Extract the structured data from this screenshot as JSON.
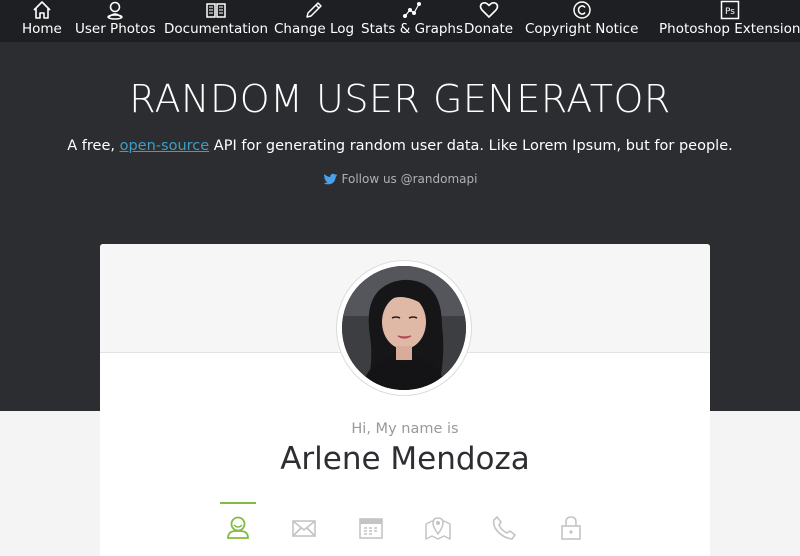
{
  "nav": {
    "items": [
      {
        "label": "Home",
        "icon": "home-icon"
      },
      {
        "label": "User Photos",
        "icon": "user-photos-icon"
      },
      {
        "label": "Documentation",
        "icon": "book-icon"
      },
      {
        "label": "Change Log",
        "icon": "pencil-icon"
      },
      {
        "label": "Stats & Graphs",
        "icon": "graph-icon"
      },
      {
        "label": "Donate",
        "icon": "heart-icon"
      },
      {
        "label": "Copyright Notice",
        "icon": "copyright-icon"
      },
      {
        "label": "Photoshop Extension",
        "icon": "photoshop-icon"
      }
    ]
  },
  "hero": {
    "title": "RANDOM USER GENERATOR",
    "tagline_before": "A free, ",
    "tagline_link": "open-source",
    "tagline_after": " API for generating random user data. Like Lorem Ipsum, but for people.",
    "follow": "Follow us @randomapi"
  },
  "card": {
    "greeting": "Hi, My name is",
    "name": "Arlene Mendoza",
    "tabs": [
      {
        "icon": "user-icon",
        "active": true
      },
      {
        "icon": "envelope-icon",
        "active": false
      },
      {
        "icon": "calendar-icon",
        "active": false
      },
      {
        "icon": "map-icon",
        "active": false
      },
      {
        "icon": "phone-icon",
        "active": false
      },
      {
        "icon": "lock-icon",
        "active": false
      }
    ]
  },
  "colors": {
    "nav_bg": "#1e1f22",
    "hero_bg": "#2c2d30",
    "link": "#3e9ec4",
    "accent_green": "#83ba43",
    "icon_gray": "#c4c4c4",
    "twitter": "#4aa1eb"
  }
}
